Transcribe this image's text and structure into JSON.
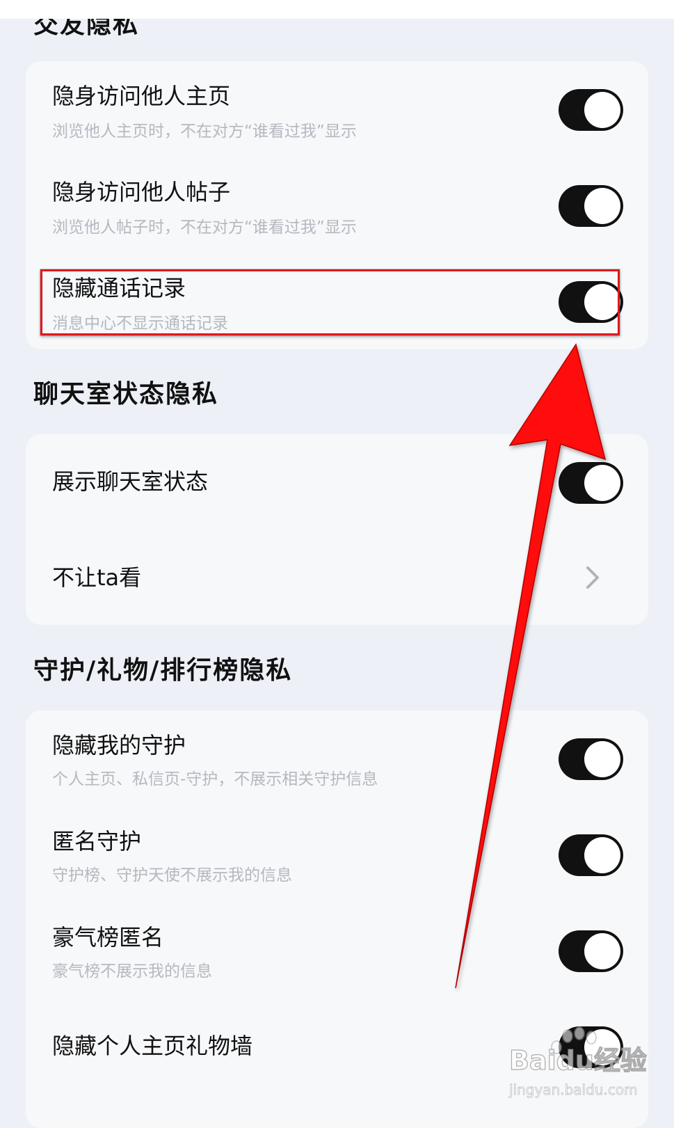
{
  "sections": [
    {
      "title": "交友隐私",
      "rows": [
        {
          "title": "隐身访问他人主页",
          "desc": "浏览他人主页时，不在对方“谁看过我”显示",
          "toggle": "on"
        },
        {
          "title": "隐身访问他人帖子",
          "desc": "浏览他人帖子时，不在对方“谁看过我”显示",
          "toggle": "on"
        },
        {
          "title": "隐藏通话记录",
          "desc": "消息中心不显示通话记录",
          "toggle": "on",
          "highlighted": true
        }
      ]
    },
    {
      "title": "聊天室状态隐私",
      "rows": [
        {
          "title": "展示聊天室状态",
          "toggle": "on"
        },
        {
          "title": "不让ta看",
          "control": "chevron-right"
        }
      ]
    },
    {
      "title": "守护/礼物/排行榜隐私",
      "rows": [
        {
          "title": "隐藏我的守护",
          "desc": "个人主页、私信页-守护，不展示相关守护信息",
          "toggle": "on"
        },
        {
          "title": "匿名守护",
          "desc": "守护榜、守护天使不展示我的信息",
          "toggle": "on"
        },
        {
          "title": "豪气榜匿名",
          "desc": "豪气榜不展示我的信息",
          "toggle": "on"
        },
        {
          "title": "隐藏个人主页礼物墙",
          "toggle": "on"
        }
      ]
    }
  ],
  "watermark": {
    "brand": "Baidu经验",
    "url": "jingyan.baidu.com"
  },
  "colors": {
    "background": "#edf0f6",
    "card": "#f7f8fa",
    "toggle_on": "#111111",
    "annotation_red": "#e0171f"
  },
  "icons": [
    "chevron-right-icon",
    "annotation-arrow",
    "baidu-paw-logo"
  ]
}
